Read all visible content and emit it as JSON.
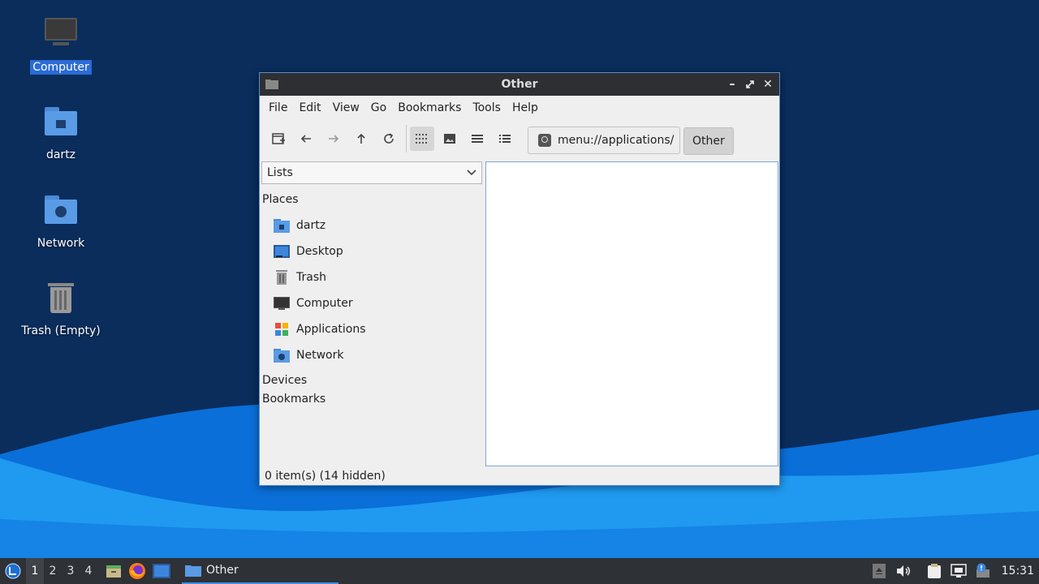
{
  "desktop": {
    "icons": [
      {
        "label": "Computer",
        "icon": "computer-icon",
        "selected": true
      },
      {
        "label": "dartz",
        "icon": "home-folder-icon"
      },
      {
        "label": "Network",
        "icon": "network-folder-icon"
      },
      {
        "label": "Trash (Empty)",
        "icon": "trash-icon"
      }
    ]
  },
  "window": {
    "title": "Other",
    "menu": [
      "File",
      "Edit",
      "View",
      "Go",
      "Bookmarks",
      "Tools",
      "Help"
    ],
    "toolbar": {
      "buttons": [
        "new-tab-icon",
        "back-arrow-icon",
        "forward-arrow-icon",
        "up-arrow-icon",
        "reload-icon",
        "icon-view-icon",
        "thumbnail-view-icon",
        "compact-view-icon",
        "detailed-list-icon"
      ],
      "active_view": "icon-view-icon"
    },
    "location": "menu://applications/",
    "breadcrumb": "Other",
    "side_pane": {
      "selector": "Lists",
      "places_heading": "Places",
      "places": [
        "dartz",
        "Desktop",
        "Trash",
        "Computer",
        "Applications",
        "Network"
      ],
      "devices_heading": "Devices",
      "bookmarks_heading": "Bookmarks"
    },
    "status": "0 item(s) (14 hidden)"
  },
  "taskbar": {
    "workspaces": [
      "1",
      "2",
      "3",
      "4"
    ],
    "active_workspace": "1",
    "task_label": "Other",
    "clock": "15:31"
  },
  "colors": {
    "desktop_dark": "#0a2d5c",
    "wave_light": "#1f9af0",
    "wave_mid": "#0a6fd8",
    "selection": "#2a6bd6",
    "titlebar": "#2e2f33",
    "taskbar": "#2e3136"
  }
}
